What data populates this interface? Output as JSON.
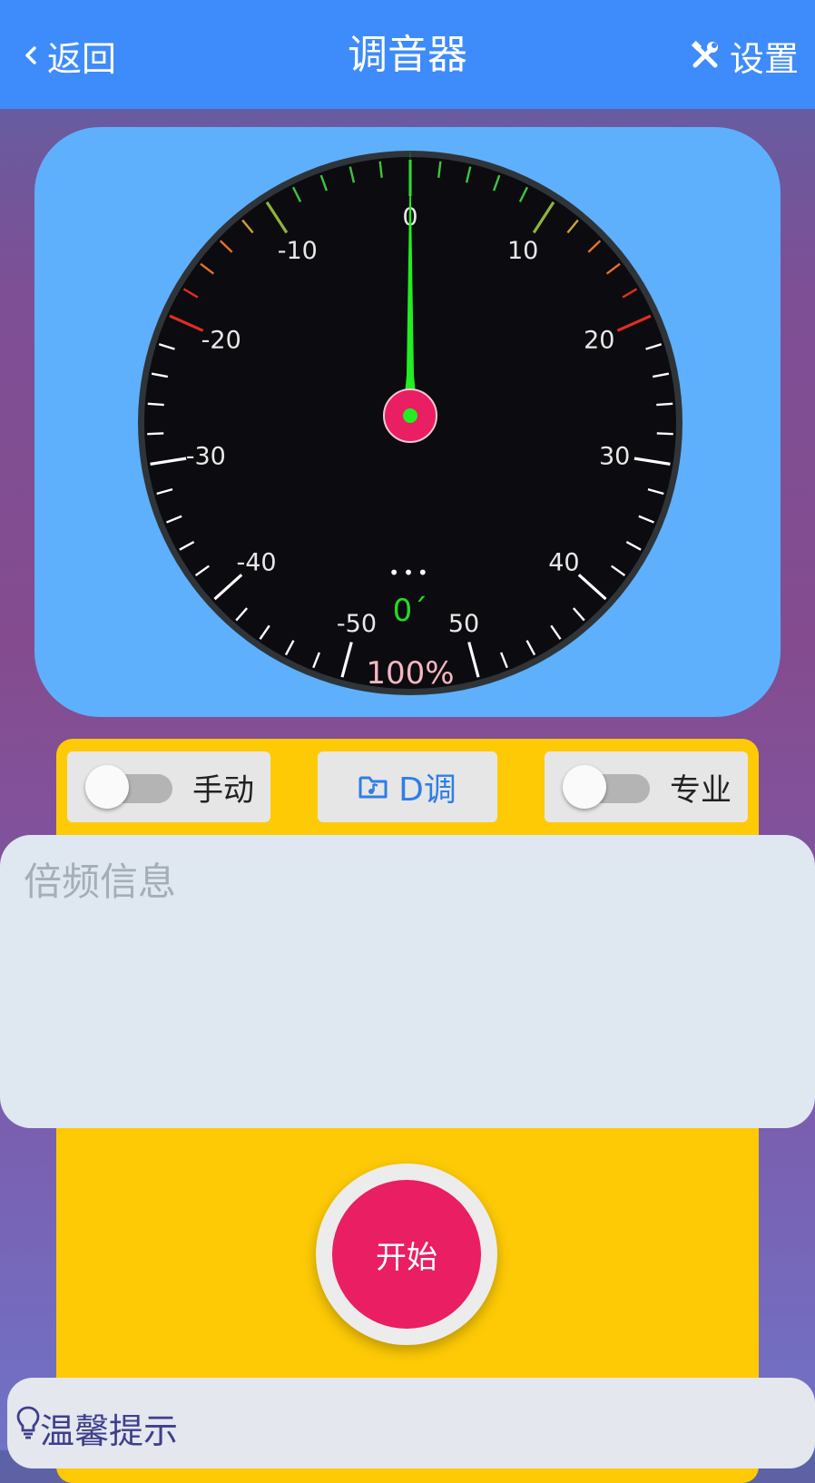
{
  "header": {
    "back_label": "返回",
    "title": "调音器",
    "settings_label": "设置",
    "background_color": "#3e8bfb"
  },
  "gauge": {
    "tick_labels": [
      "-50",
      "-40",
      "-30",
      "-20",
      "-10",
      "0",
      "10",
      "20",
      "30",
      "40",
      "50"
    ],
    "needle_value": 0,
    "cents_text": "0´",
    "percent_text": "100%",
    "dots_text": "•••",
    "needle_color": "#22ee22",
    "hub_color": "#e91e63",
    "card_color": "#5eb0fc"
  },
  "controls": {
    "manual": {
      "label": "手动",
      "on": false
    },
    "key": {
      "label": "D调",
      "icon": "music-folder-icon"
    },
    "pro": {
      "label": "专业",
      "on": false
    }
  },
  "info": {
    "title": "倍频信息"
  },
  "start": {
    "label": "开始",
    "color": "#e91e63"
  },
  "tips": {
    "title": "温馨提示",
    "icon": "lightbulb-icon"
  }
}
